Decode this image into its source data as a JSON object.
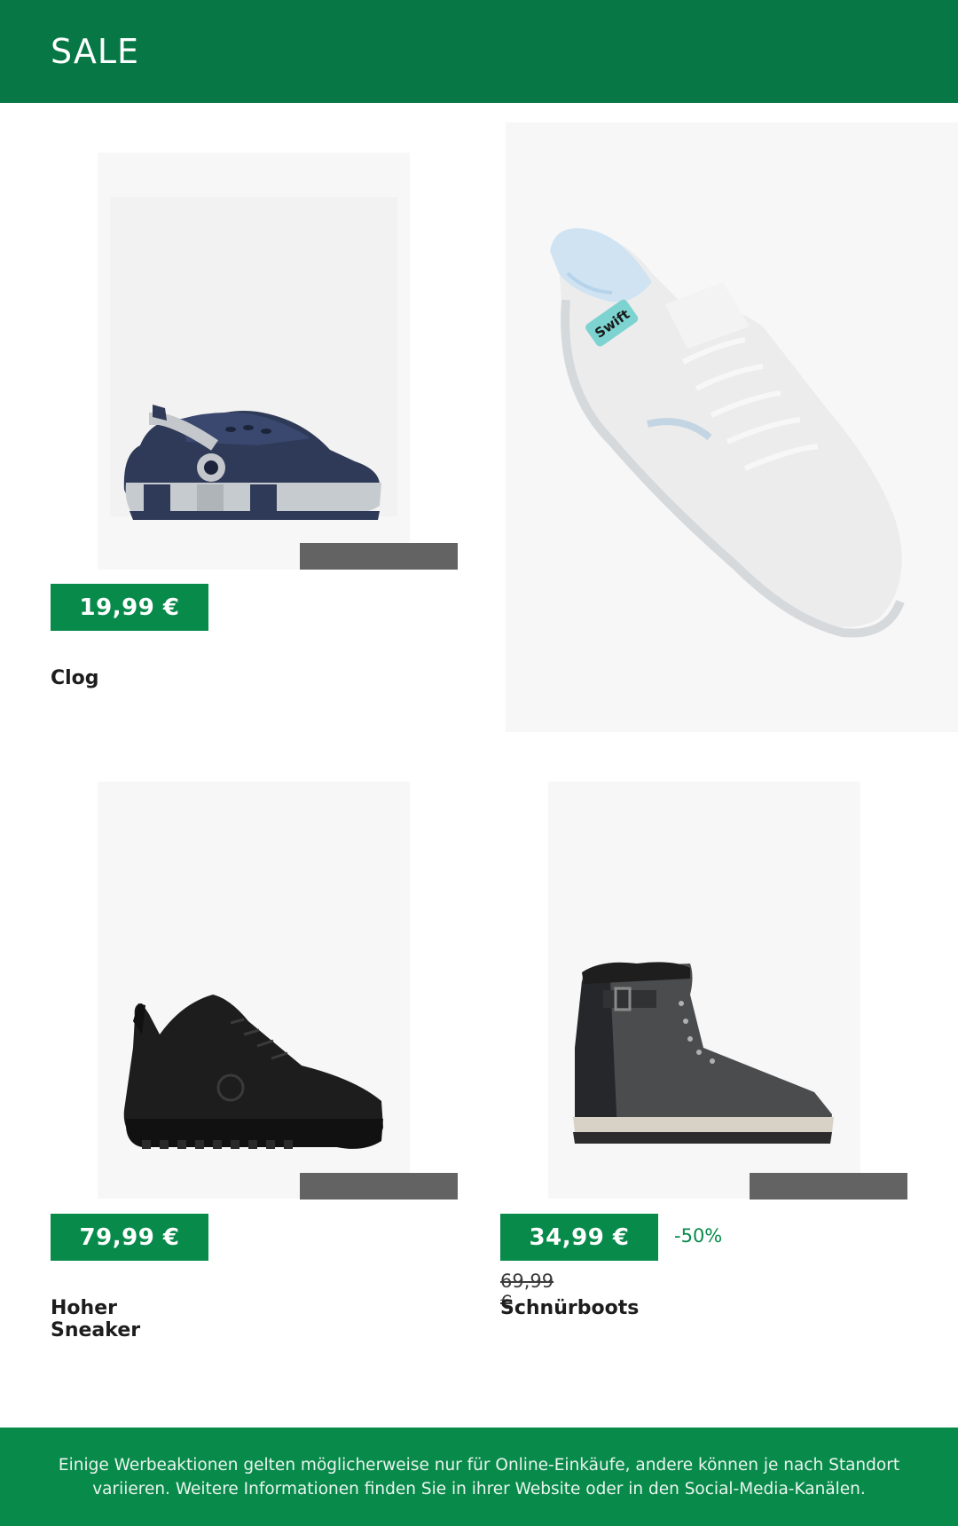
{
  "header": {
    "title": "SALE"
  },
  "products": [
    {
      "name": "Clog",
      "price": "19,99 €",
      "image_icon": "clog-shoe-image"
    },
    {
      "name": "",
      "price": "",
      "image_icon": "white-slip-on-sneaker-image",
      "image_label": "Swift"
    },
    {
      "name": "Hoher Sneaker",
      "price": "79,99 €",
      "image_icon": "black-high-sneaker-image"
    },
    {
      "name": "Schnürboots",
      "price": "34,99 €",
      "old_price": "69,99 €",
      "discount": "-50%",
      "image_icon": "lace-up-boot-image"
    }
  ],
  "footer": {
    "disclaimer": "Einige Werbeaktionen gelten möglicherweise nur für Online-Einkäufe, andere können je nach Standort variieren. Weitere Informationen finden Sie in ihrer Website oder in den Social-Media-Kanälen."
  },
  "colors": {
    "header_bg": "#077745",
    "accent": "#088a4b",
    "tag": "#636363",
    "photo_bg": "#f7f7f7"
  }
}
